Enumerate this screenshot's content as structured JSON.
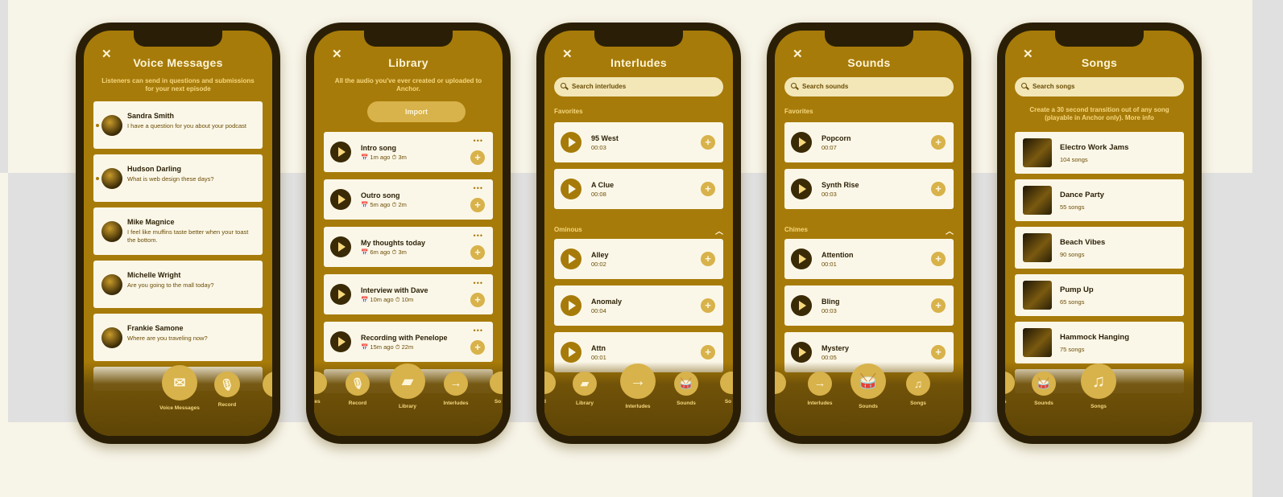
{
  "close_glyph": "✕",
  "phones": {
    "voice": {
      "title": "Voice Messages",
      "subtitle": "Listeners can send in questions and submissions for your next episode",
      "items": [
        {
          "name": "Sandra Smith",
          "msg": "I have a question for you about your podcast"
        },
        {
          "name": "Hudson Darling",
          "msg": "What is web design these days?"
        },
        {
          "name": "Mike Magnice",
          "msg": "I feel like muffins taste better when your toast the bottom."
        },
        {
          "name": "Michelle Wright",
          "msg": "Are you going to the mall today?"
        },
        {
          "name": "Frankie Samone",
          "msg": "Where are you traveling now?"
        }
      ],
      "nav": {
        "active": "Voice Messages",
        "record": "Record"
      }
    },
    "library": {
      "title": "Library",
      "subtitle": "All the audio you've ever created or uploaded to Anchor.",
      "import": "Import",
      "items": [
        {
          "name": "Intro song",
          "meta": "📅 1m ago   ⏱ 3m"
        },
        {
          "name": "Outro song",
          "meta": "📅 5m ago   ⏱ 2m"
        },
        {
          "name": "My thoughts today",
          "meta": "📅 6m ago   ⏱ 3m"
        },
        {
          "name": "Interview with Dave",
          "meta": "📅 10m ago   ⏱ 10m"
        },
        {
          "name": "Recording with Penelope",
          "meta": "📅 15m ago   ⏱ 22m"
        }
      ],
      "nav": {
        "left": "ges",
        "record": "Record",
        "active": "Library",
        "interludes": "Interludes",
        "right": "So"
      }
    },
    "interludes": {
      "title": "Interludes",
      "search": "Search interludes",
      "section1": "Favorites",
      "section2": "Ominous",
      "fav": [
        {
          "name": "95 West",
          "dur": "00:03"
        },
        {
          "name": "A Clue",
          "dur": "00:08"
        }
      ],
      "items": [
        {
          "name": "Alley",
          "dur": "00:02"
        },
        {
          "name": "Anomaly",
          "dur": "00:04"
        },
        {
          "name": "Attn",
          "dur": "00:01"
        }
      ],
      "nav": {
        "left": "d",
        "library": "Library",
        "active": "Interludes",
        "sounds": "Sounds",
        "right": "So"
      }
    },
    "sounds": {
      "title": "Sounds",
      "search": "Search sounds",
      "section1": "Favorites",
      "section2": "Chimes",
      "fav": [
        {
          "name": "Popcorn",
          "dur": "00:07"
        },
        {
          "name": "Synth Rise",
          "dur": "00:03"
        }
      ],
      "items": [
        {
          "name": "Attention",
          "dur": "00:01"
        },
        {
          "name": "Bling",
          "dur": "00:03"
        },
        {
          "name": "Mystery",
          "dur": "00:05"
        }
      ],
      "nav": {
        "interludes": "Interludes",
        "active": "Sounds",
        "songs": "Songs"
      }
    },
    "songs": {
      "title": "Songs",
      "search": "Search songs",
      "subtitle": "Create a 30 second transition out of any song (playable in Anchor only). More info",
      "items": [
        {
          "name": "Electro Work Jams",
          "count": "104 songs"
        },
        {
          "name": "Dance Party",
          "count": "55 songs"
        },
        {
          "name": "Beach Vibes",
          "count": "90 songs"
        },
        {
          "name": "Pump Up",
          "count": "65 songs"
        },
        {
          "name": "Hammock Hanging",
          "count": "75 songs"
        }
      ],
      "nav": {
        "left": "es",
        "sounds": "Sounds",
        "active": "Songs"
      }
    }
  }
}
